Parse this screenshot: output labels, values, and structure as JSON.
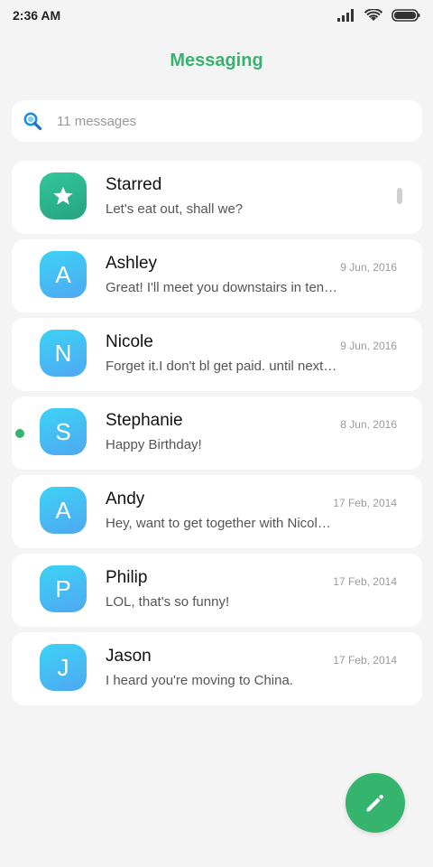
{
  "status": {
    "time": "2:36 AM"
  },
  "header": {
    "title": "Messaging"
  },
  "search": {
    "placeholder": "11 messages"
  },
  "conversations": [
    {
      "name": "Starred",
      "preview": "Let's eat out, shall we?",
      "date": "",
      "avatar": "star-icon"
    },
    {
      "name": "Ashley",
      "preview": "Great! I'll meet you downstairs in ten…",
      "date": "9 Jun, 2016",
      "avatar": "A"
    },
    {
      "name": "Nicole",
      "preview": "Forget it.I don't bl get paid. until next…",
      "date": "9 Jun, 2016",
      "avatar": "N"
    },
    {
      "name": "Stephanie",
      "preview": "Happy Birthday!",
      "date": "8 Jun, 2016",
      "avatar": "S",
      "unread": true
    },
    {
      "name": "Andy",
      "preview": "Hey, want to get together with Nicol…",
      "date": "17 Feb, 2014",
      "avatar": "A"
    },
    {
      "name": "Philip",
      "preview": "LOL, that's so funny!",
      "date": "17 Feb, 2014",
      "avatar": "P"
    },
    {
      "name": "Jason",
      "preview": "I heard you're moving to China.",
      "date": "17 Feb, 2014",
      "avatar": "J"
    }
  ],
  "colors": {
    "accent": "#35b46d",
    "avatar_blue": "#4fa7f2",
    "avatar_green": "#26a37f"
  },
  "icons": {
    "search": "search-icon",
    "compose": "pencil-icon"
  }
}
